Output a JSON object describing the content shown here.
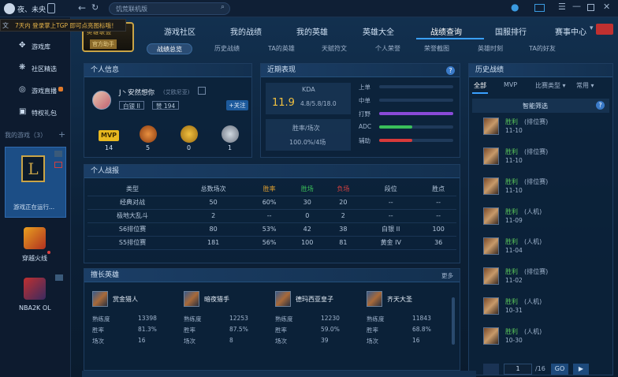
{
  "topbar": {
    "user_name": "夜、未央",
    "notice": "7天内 登录掌上TGP 即可点亮图标哦！",
    "search_placeholder": "饥荒联机版",
    "left_tag": "文"
  },
  "sidebar": {
    "items": [
      {
        "label": "游戏库",
        "icon": "gamepad-icon"
      },
      {
        "label": "社区精选",
        "icon": "community-icon"
      },
      {
        "label": "游戏直播",
        "icon": "live-icon"
      },
      {
        "label": "特权礼包",
        "icon": "gift-icon"
      }
    ],
    "my_games_label": "我的游戏（3）",
    "add_label": "+",
    "running_label": "游戏正在运行...",
    "games": [
      "穿越火线",
      "NBA2K OL"
    ],
    "lol_letter": "L"
  },
  "nav": {
    "logo_text": "英雄联盟",
    "logo_sub": "官方助手",
    "tabs": [
      "游戏社区",
      "我的战绩",
      "我的英雄",
      "英雄大全",
      "战绩查询",
      "国服排行",
      "赛事中心"
    ],
    "active_tab": "战绩查询",
    "subtabs": [
      "战绩总览",
      "历史战绩",
      "TA的英雄",
      "天赋符文",
      "个人荣誉",
      "荣誉截图",
      "英雄时刻",
      "TA的好友"
    ]
  },
  "profile": {
    "title": "个人信息",
    "name": "J丶安然想你",
    "server": "(艾欧尼亚)",
    "rank": "白银 II",
    "likes": "赞 194",
    "follow": "+关注",
    "badges": [
      {
        "label": "MVP",
        "count": "14"
      },
      {
        "label": "",
        "count": "5"
      },
      {
        "label": "",
        "count": "0"
      },
      {
        "label": "",
        "count": "1"
      }
    ]
  },
  "recent": {
    "title": "近期表现",
    "kda_label": "KDA",
    "kda_value": "11.9",
    "kda_detail": "4.8/5.8/18.0",
    "winrate_label": "胜率/场次",
    "winrate_value": "100.0%/4场",
    "roles": [
      {
        "name": "上单",
        "value": 0.0,
        "color": "#7a4ad8"
      },
      {
        "name": "中单",
        "value": 0.0,
        "color": "#4a8ad8"
      },
      {
        "name": "打野",
        "value": 1.0,
        "color": "#8a4ad8"
      },
      {
        "name": "ADC",
        "value": 0.45,
        "color": "#3abf5a"
      },
      {
        "name": "辅助",
        "value": 0.45,
        "color": "#d83a3a"
      }
    ]
  },
  "stats": {
    "title": "个人战报",
    "headers": [
      "类型",
      "总数场次",
      "胜率",
      "胜场",
      "负场",
      "段位",
      "胜点"
    ],
    "rows": [
      [
        "经典对战",
        "50",
        "60%",
        "30",
        "20",
        "--",
        "--"
      ],
      [
        "极地大乱斗",
        "2",
        "--",
        "0",
        "2",
        "--",
        "--"
      ],
      [
        "S6排位赛",
        "80",
        "53%",
        "42",
        "38",
        "白银 II",
        "100"
      ],
      [
        "S5排位赛",
        "181",
        "56%",
        "100",
        "81",
        "黄金 IV",
        "36"
      ]
    ]
  },
  "heroes": {
    "title": "擅长英雄",
    "more": "更多",
    "list": [
      {
        "name": "赏金猎人",
        "proficiency": "13398",
        "winrate": "81.3%",
        "games": "16"
      },
      {
        "name": "暗夜猎手",
        "proficiency": "12253",
        "winrate": "87.5%",
        "games": "8"
      },
      {
        "name": "德玛西亚皇子",
        "proficiency": "12230",
        "winrate": "59.0%",
        "games": "39"
      },
      {
        "name": "齐天大圣",
        "proficiency": "11843",
        "winrate": "68.8%",
        "games": "16"
      }
    ],
    "labels": {
      "proficiency": "熟练度",
      "winrate": "胜率",
      "games": "场次"
    }
  },
  "history": {
    "title": "历史战绩",
    "filters": [
      "全部",
      "MVP",
      "比赛类型 ▾",
      "常用 ▾"
    ],
    "smart_filter": "智能筛选",
    "items": [
      {
        "result": "胜利",
        "mode": "(排位赛)",
        "date": "11-10"
      },
      {
        "result": "胜利",
        "mode": "(排位赛)",
        "date": "11-10"
      },
      {
        "result": "胜利",
        "mode": "(排位赛)",
        "date": "11-10"
      },
      {
        "result": "胜利",
        "mode": "(人机)",
        "date": "11-09"
      },
      {
        "result": "胜利",
        "mode": "(人机)",
        "date": "11-04"
      },
      {
        "result": "胜利",
        "mode": "(排位赛)",
        "date": "11-02"
      },
      {
        "result": "胜利",
        "mode": "(人机)",
        "date": "10-31"
      },
      {
        "result": "胜利",
        "mode": "(人机)",
        "date": "10-30"
      }
    ],
    "pager": {
      "current": "1",
      "total": "/16",
      "go": "GO"
    }
  }
}
